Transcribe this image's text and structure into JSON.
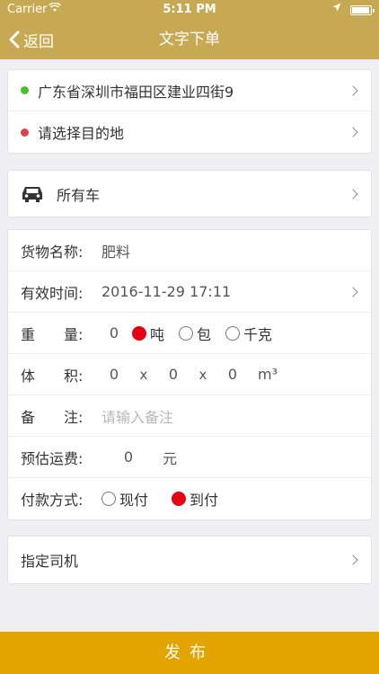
{
  "status_bar": {
    "carrier": "Carrier",
    "time": "5:11 PM"
  },
  "nav": {
    "back_label": "返回",
    "title": "文字下单"
  },
  "route": {
    "origin": "广东省深圳市福田区建业四街9",
    "destination": "请选择目的地",
    "origin_color": "#4cc02b",
    "destination_color": "#e0404a"
  },
  "vehicle": {
    "label": "所有车"
  },
  "form": {
    "cargo_label": "货物名称:",
    "cargo_value": "肥料",
    "time_label": "有效时间:",
    "time_value": "2016-11-29 17:11",
    "weight_label": "重　　量:",
    "weight_value": "0",
    "weight_units": [
      "吨",
      "包",
      "千克"
    ],
    "weight_selected": "吨",
    "volume_label": "体　　积:",
    "volume_values": [
      "0",
      "0",
      "0"
    ],
    "volume_times": "x",
    "volume_unit": "m³",
    "remark_label": "备　　注:",
    "remark_placeholder": "请输入备注",
    "fee_label": "预估运费:",
    "fee_value": "0",
    "fee_unit": "元",
    "payment_label": "付款方式:",
    "payment_options": [
      "现付",
      "到付"
    ],
    "payment_selected": "到付"
  },
  "driver": {
    "label": "指定司机"
  },
  "publish_label": "发布",
  "colors": {
    "nav_bg": "#c8a953",
    "publish_bg": "#e3a400",
    "radio_on": "#e60012"
  }
}
